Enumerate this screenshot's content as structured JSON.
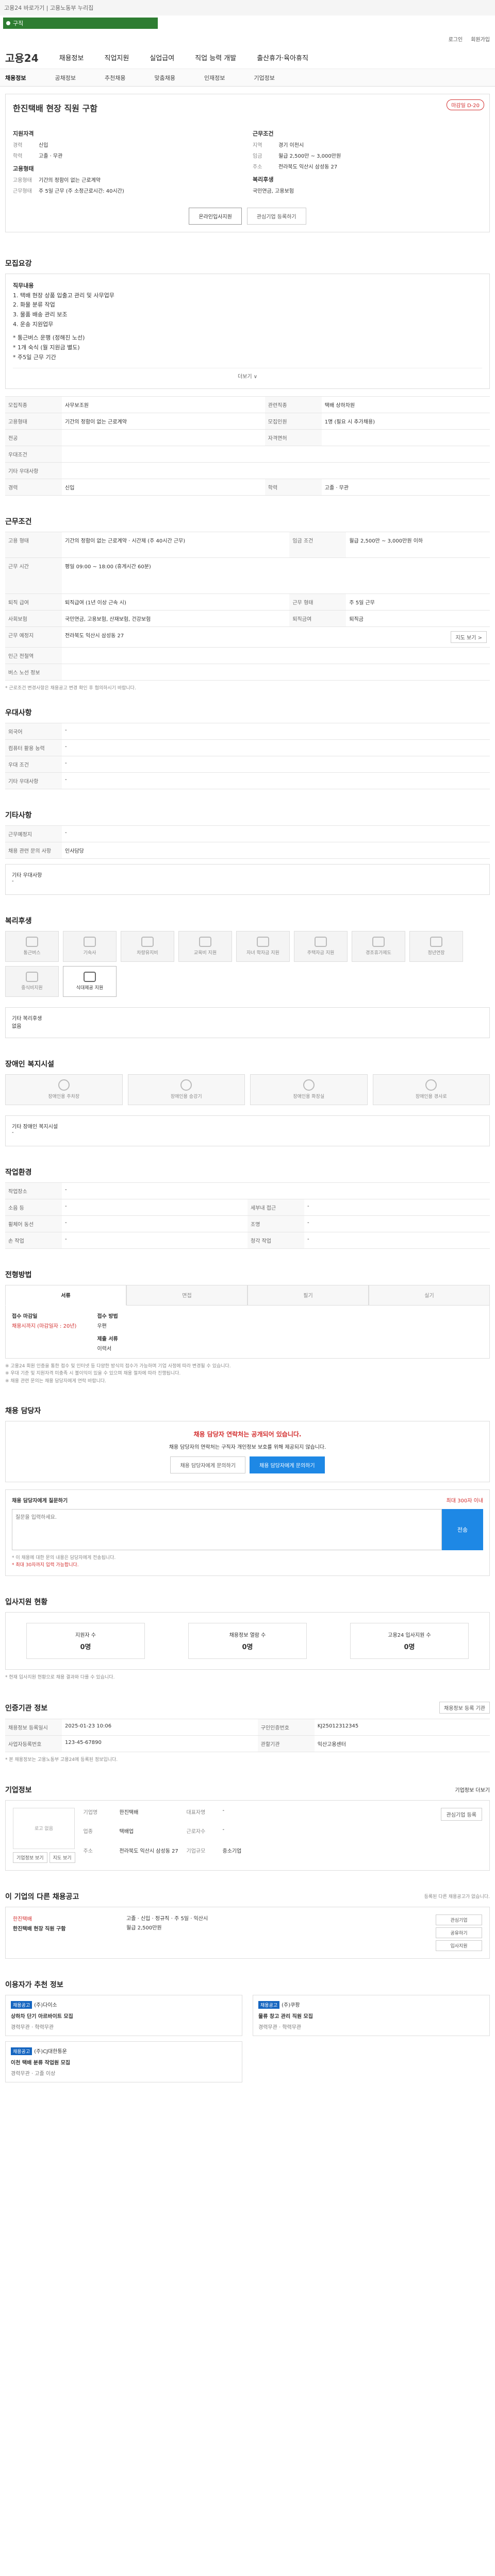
{
  "topbar": {
    "text": "고용24 바로가기 | 고용노동부 누리집"
  },
  "search": {
    "value": "구직"
  },
  "util": {
    "login": "로그인",
    "join": "회원가입"
  },
  "header": {
    "logo": "고용24",
    "nav": [
      "채용정보",
      "직업지원",
      "실업급여",
      "직업 능력 개발",
      "출산휴가·육아휴직"
    ]
  },
  "subnav": [
    "채용정보",
    "공채정보",
    "추천채용",
    "맞춤채용",
    "인재정보",
    "기업정보"
  ],
  "job": {
    "badge": "마감일 D-20",
    "title": "한진택배 현장 직원 구함",
    "left_title": "지원자격",
    "left": [
      {
        "k": "경력",
        "v": "신입"
      },
      {
        "k": "학력",
        "v": "고졸 · 무관"
      }
    ],
    "employment_title": "고용형태",
    "employment": [
      {
        "k": "고용형태",
        "v": "기간의 정함이 없는 근로계약"
      },
      {
        "k": "근무형태",
        "v": "주 5일 근무 (주 소정근로시간: 40시간)"
      }
    ],
    "right_title": "근무조건",
    "right": [
      {
        "k": "지역",
        "v": "경기 이천시"
      },
      {
        "k": "임금",
        "v": "월급 2,500만 ~ 3,000만원"
      },
      {
        "k": "주소",
        "v": "전라북도 익산시 삼성동 27"
      }
    ],
    "welfare_title": "복리후생",
    "welfare_v": "국민연금, 고용보험",
    "btn_apply": "온라인입사지원",
    "btn_save": "관심기업 등록하기"
  },
  "recruit": {
    "title": "모집요강",
    "body": [
      "직무내용",
      "1. 택배 현장 상품 입출고 관리 및 사무업무",
      "2. 화물 분류 작업",
      "3. 물품 배송 관리 보조",
      "4. 운송 지원업무",
      "",
      "* 통근버스 운행 (정해진 노선)",
      "* 1개 숙식 (월 지원금 별도)",
      "* 주5일 근무 기간"
    ],
    "more": "더보기 ∨",
    "rows": [
      [
        "모집직종",
        "사무보조원",
        "관련직종",
        "택배 상하차원"
      ],
      [
        "고용형태",
        "기간의 정함이 없는 근로계약",
        "모집인원",
        "1명 (필요 시 추가채용)"
      ],
      [
        "전공",
        "",
        "자격면허",
        ""
      ],
      [
        "우대조건",
        "",
        "",
        ""
      ],
      [
        "기타 우대사항",
        "",
        "",
        ""
      ],
      [
        "경력",
        "신입",
        "학력",
        "고졸 · 무관"
      ]
    ]
  },
  "conditions": {
    "title": "근무조건",
    "rows": [
      [
        "고용 형태",
        "기간의 정함이 없는 근로계약 · 시간제 (주 40시간 근무)",
        "임금 조건",
        "월급 2,500만 ~ 3,000만원 이하"
      ],
      [
        "근무 시간",
        "평일 09:00 ~ 18:00 (휴게시간 60분)",
        "",
        ""
      ],
      [
        "퇴직 급여",
        "퇴직급여 (1년 이상 근속 시)",
        "근무 형태",
        "주 5일 근무"
      ],
      [
        "사회보험",
        "국민연금, 고용보험, 산재보험, 건강보험",
        "퇴직금여",
        "퇴직금"
      ],
      [
        "근무 예정지",
        "전라북도 익산시 삼성동 27",
        "",
        ""
      ],
      [
        "인근 전철역",
        "",
        "",
        ""
      ],
      [
        "버스 노선 정보",
        "",
        "",
        ""
      ]
    ],
    "map_btn": "지도 보기 >",
    "footnote": "* 근로조건 변경사항은 채용공고 변경 확인 후 협의하시기 바랍니다."
  },
  "prefs": {
    "title": "우대사항",
    "rows": [
      [
        "외국어",
        "-"
      ],
      [
        "컴퓨터 활용 능력",
        "-"
      ],
      [
        "우대 조건",
        "-"
      ],
      [
        "기타 우대사항",
        "-"
      ]
    ]
  },
  "other": {
    "title": "기타사항",
    "rows": [
      [
        "근무예정지",
        "-"
      ],
      [
        "채용 관련 문의 사항",
        "인사담당"
      ]
    ],
    "note_label": "기타 우대사항",
    "note_value": "-"
  },
  "benefits": {
    "title": "복리후생",
    "items": [
      "통근버스",
      "기숙사",
      "차량유지비",
      "교육비 지원",
      "자녀 학자금 지원",
      "주택자금 지원",
      "경조휴가제도",
      "정년연장",
      "중식비지원",
      "식대제공 지원"
    ],
    "active_index": 9,
    "extra_label": "기타 복리후생",
    "extra_value": "없음"
  },
  "disability": {
    "title": "장애인 복지시설",
    "items": [
      "장애인용 주차장",
      "장애인용 승강기",
      "장애인용 화장실",
      "장애인용 경사로"
    ],
    "extra_label": "기타 장애인 복지시설",
    "extra_value": "-"
  },
  "env": {
    "title": "작업환경",
    "rows": [
      [
        "작업장소",
        "-",
        "",
        ""
      ],
      [
        "소음 등",
        "-",
        "세부내 접근",
        "-"
      ],
      [
        "휠체어 동선",
        "-",
        "조명",
        "-"
      ],
      [
        "손 작업",
        "-",
        "청각 작업",
        "-"
      ]
    ]
  },
  "selection": {
    "title": "전형방법",
    "tabs": [
      "서류",
      "면접",
      "필기",
      "실기"
    ],
    "doc_label": "접수 마감일",
    "doc_value": "채용시까지 (마감일자 : 20년)",
    "method_label": "접수 방법",
    "method_value": "우편",
    "form_label": "제출 서류",
    "form_value": "이력서",
    "notices": [
      "※ 고용24 회원 인증을 통한 접수 및 인터넷 등 다양한 방식의 접수가 가능하며 기업 사정에 따라 변경될 수 있습니다.",
      "※ 우대 기준 및 지원자격 미충족 시 불이익이 있을 수 있으며 채용 절차에 따라 진행됩니다.",
      "※ 채용 관련 문의는 채용 담당자에게 연락 바랍니다."
    ]
  },
  "contact": {
    "title": "채용 담당자",
    "head": "채용 담당자 연락처는 공개되어 있습니다.",
    "body": "채용 담당자의 연락처는 구직자 개인정보 보호를 위해 제공되지 않습니다.",
    "btn_a": "채용 담당자에게 문의하기",
    "btn_b": "채용 담당자에게 문의하기",
    "q_label": "채용 담당자에게 질문하기",
    "q_hint": "최대 300자 이내",
    "q_placeholder": "질문을 입력하세요.",
    "q_send": "전송",
    "q_notice1": "* 이 채용에 대한 문의 내용은 담당자에게 전송됩니다.",
    "q_notice2": "* 최대 30자까지 입력 가능합니다."
  },
  "stats": {
    "title": "입사지원 현황",
    "items": [
      {
        "label": "지원자 수",
        "value": "0명"
      },
      {
        "label": "채용정보 열람 수",
        "value": "0명"
      },
      {
        "label": "고용24 입사지원 수",
        "value": "0명"
      }
    ],
    "footnote": "* 현재 입사지원 현황으로 채용 결과와 다를 수 있습니다."
  },
  "post": {
    "title": "인증기관 정보",
    "btn": "채용정보 등록 기관",
    "rows": [
      [
        "채용정보 등록일시",
        "2025-01-23 10:06",
        "구인인증번호",
        "KJ25012312345"
      ],
      [
        "사업자등록번호",
        "123-45-67890",
        "관할기관",
        "익산고용센터"
      ]
    ],
    "notice": "* 본 채용정보는 고용노동부 고용24에 등록된 정보입니다."
  },
  "company": {
    "title": "기업정보",
    "btn": "기업정보 더보기",
    "logo_label": "로고 없음",
    "name_k": "기업명",
    "name_v": "한진택배",
    "rep_k": "대표자명",
    "rep_v": "-",
    "ind_k": "업종",
    "ind_v": "택배업",
    "emp_k": "근로자수",
    "emp_v": "-",
    "addr_k": "주소",
    "addr_v": "전라북도 익산시 삼성동 27",
    "size_k": "기업규모",
    "size_v": "중소기업",
    "btn_view": "기업정보 보기",
    "btn_map": "지도 보기",
    "btn_follow": "관심기업 등록"
  },
  "other_jobs": {
    "title": "이 기업의 다른 채용공고",
    "hint": "등록된 다른 채용공고가 없습니다.",
    "company": "한진택배",
    "job_title": "한진택배 현장 직원 구함",
    "tags": [
      "고졸",
      "신입",
      "정규직",
      "주 5일",
      "익산시"
    ],
    "wage": "월급 2,500만원",
    "side_btns": [
      "관심기업",
      "공유하기",
      "입사지원"
    ]
  },
  "recommend": {
    "title": "이용자가 추천 정보",
    "items": [
      {
        "tag": "채용공고",
        "company": "(주)다이소",
        "title": "상하차 단기 아르바이트 모집",
        "meta": "경력무관 · 학력무관"
      },
      {
        "tag": "채용공고",
        "company": "(주)쿠팡",
        "title": "물류 창고 관리 직원 모집",
        "meta": "경력무관 · 학력무관"
      },
      {
        "tag": "채용공고",
        "company": "(주)CJ대한통운",
        "title": "이천 택배 분류 작업원 모집",
        "meta": "경력무관 · 고졸 이상"
      }
    ]
  }
}
